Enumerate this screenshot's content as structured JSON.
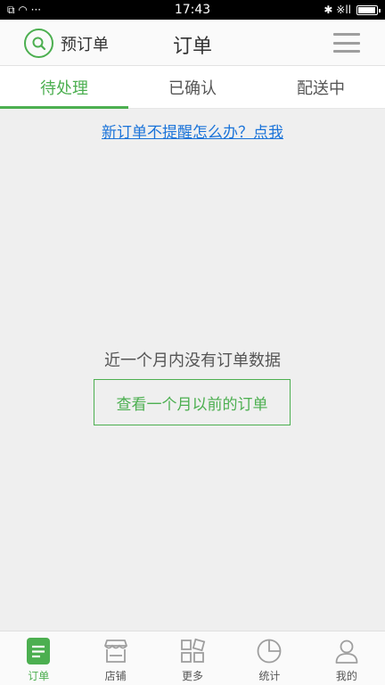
{
  "status_bar": {
    "time": "17:43",
    "left_glyphs": "⧉ ◠ ···",
    "right_glyphs": "✱ ※ll",
    "battery_level": 0.95
  },
  "header": {
    "preorder_label": "预订单",
    "title": "订单"
  },
  "tabs": [
    {
      "label": "待处理",
      "active": true
    },
    {
      "label": "已确认",
      "active": false
    },
    {
      "label": "配送中",
      "active": false
    }
  ],
  "reminder_link": "新订单不提醒怎么办？点我",
  "empty_state": {
    "message": "近一个月内没有订单数据",
    "button_label": "查看一个月以前的订单"
  },
  "bottom_nav": [
    {
      "label": "订单",
      "icon": "order-icon",
      "active": true
    },
    {
      "label": "店铺",
      "icon": "store-icon",
      "active": false
    },
    {
      "label": "更多",
      "icon": "more-grid-icon",
      "active": false
    },
    {
      "label": "统计",
      "icon": "pie-chart-icon",
      "active": false
    },
    {
      "label": "我的",
      "icon": "user-icon",
      "active": false
    }
  ],
  "colors": {
    "accent": "#4caf50",
    "link": "#1a73d9",
    "background": "#efefef",
    "inactive_icon": "#9e9e9e"
  }
}
